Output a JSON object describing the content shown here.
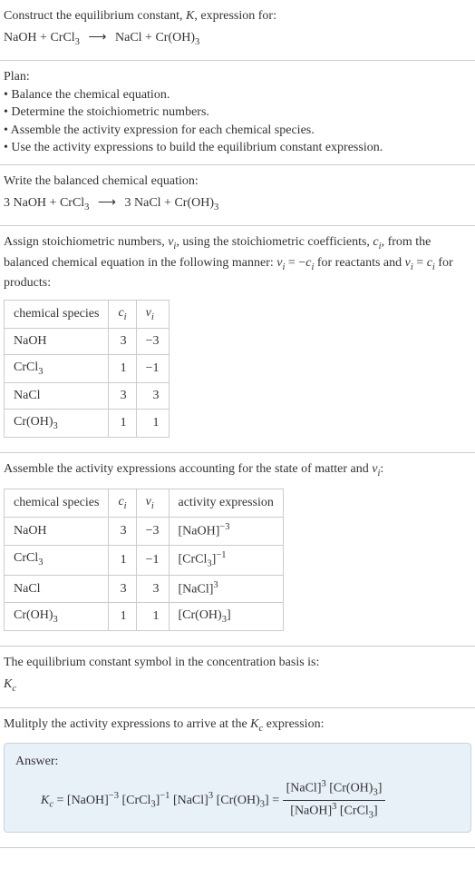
{
  "intro": {
    "line1": "Construct the equilibrium constant, ",
    "K": "K",
    "line1b": ", expression for:",
    "reactants": "NaOH + CrCl",
    "sub3a": "3",
    "arrow": "⟶",
    "products": "NaCl + Cr(OH)",
    "sub3b": "3"
  },
  "plan": {
    "title": "Plan:",
    "items": [
      "Balance the chemical equation.",
      "Determine the stoichiometric numbers.",
      "Assemble the activity expression for each chemical species.",
      "Use the activity expressions to build the equilibrium constant expression."
    ]
  },
  "balanced": {
    "title": "Write the balanced chemical equation:",
    "lhs_coef": "3 NaOH + CrCl",
    "sub3a": "3",
    "arrow": "⟶",
    "rhs": "3 NaCl + Cr(OH)",
    "sub3b": "3"
  },
  "assign": {
    "text1": "Assign stoichiometric numbers, ",
    "nu": "ν",
    "sub_i1": "i",
    "text2": ", using the stoichiometric coefficients, ",
    "c": "c",
    "sub_i2": "i",
    "text3": ", from the balanced chemical equation in the following manner: ",
    "nu2": "ν",
    "sub_i3": "i",
    "eq": " = −",
    "c2": "c",
    "sub_i4": "i",
    "text4": " for reactants and ",
    "nu3": "ν",
    "sub_i5": "i",
    "eq2": " = ",
    "c3": "c",
    "sub_i6": "i",
    "text5": " for products:"
  },
  "table1": {
    "headers": {
      "species": "chemical species",
      "c": "c",
      "c_sub": "i",
      "nu": "ν",
      "nu_sub": "i"
    },
    "rows": [
      {
        "species": "NaOH",
        "c": "3",
        "nu": "−3"
      },
      {
        "species_base": "CrCl",
        "species_sub": "3",
        "c": "1",
        "nu": "−1"
      },
      {
        "species": "NaCl",
        "c": "3",
        "nu": "3"
      },
      {
        "species_base": "Cr(OH)",
        "species_sub": "3",
        "c": "1",
        "nu": "1"
      }
    ]
  },
  "assemble": {
    "text1": "Assemble the activity expressions accounting for the state of matter and ",
    "nu": "ν",
    "sub_i": "i",
    "colon": ":"
  },
  "table2": {
    "headers": {
      "species": "chemical species",
      "c": "c",
      "c_sub": "i",
      "nu": "ν",
      "nu_sub": "i",
      "activity": "activity expression"
    },
    "rows": [
      {
        "species": "NaOH",
        "c": "3",
        "nu": "−3",
        "act_base": "[NaOH]",
        "act_sup": "−3"
      },
      {
        "species_base": "CrCl",
        "species_sub": "3",
        "c": "1",
        "nu": "−1",
        "act_base": "[CrCl",
        "act_mid_sub": "3",
        "act_close": "]",
        "act_sup": "−1"
      },
      {
        "species": "NaCl",
        "c": "3",
        "nu": "3",
        "act_base": "[NaCl]",
        "act_sup": "3"
      },
      {
        "species_base": "Cr(OH)",
        "species_sub": "3",
        "c": "1",
        "nu": "1",
        "act_base": "[Cr(OH)",
        "act_mid_sub": "3",
        "act_close": "]"
      }
    ]
  },
  "symbol": {
    "text": "The equilibrium constant symbol in the concentration basis is:",
    "K": "K",
    "sub_c": "c"
  },
  "multiply": {
    "text1": "Mulitply the activity expressions to arrive at the ",
    "K": "K",
    "sub_c": "c",
    "text2": " expression:"
  },
  "answer": {
    "label": "Answer:",
    "K": "K",
    "sub_c": "c",
    "eq": " = [NaOH]",
    "sup_n3": "−3",
    "crcl": " [CrCl",
    "sub3a": "3",
    "close1": "]",
    "sup_n1": "−1",
    "nacl": " [NaCl]",
    "sup3": "3",
    "croh": " [Cr(OH)",
    "sub3b": "3",
    "close2": "] = ",
    "num_nacl": "[NaCl]",
    "num_sup3": "3",
    "num_croh": " [Cr(OH)",
    "num_sub3": "3",
    "num_close": "]",
    "den_naoh": "[NaOH]",
    "den_sup3": "3",
    "den_crcl": " [CrCl",
    "den_sub3": "3",
    "den_close": "]"
  }
}
